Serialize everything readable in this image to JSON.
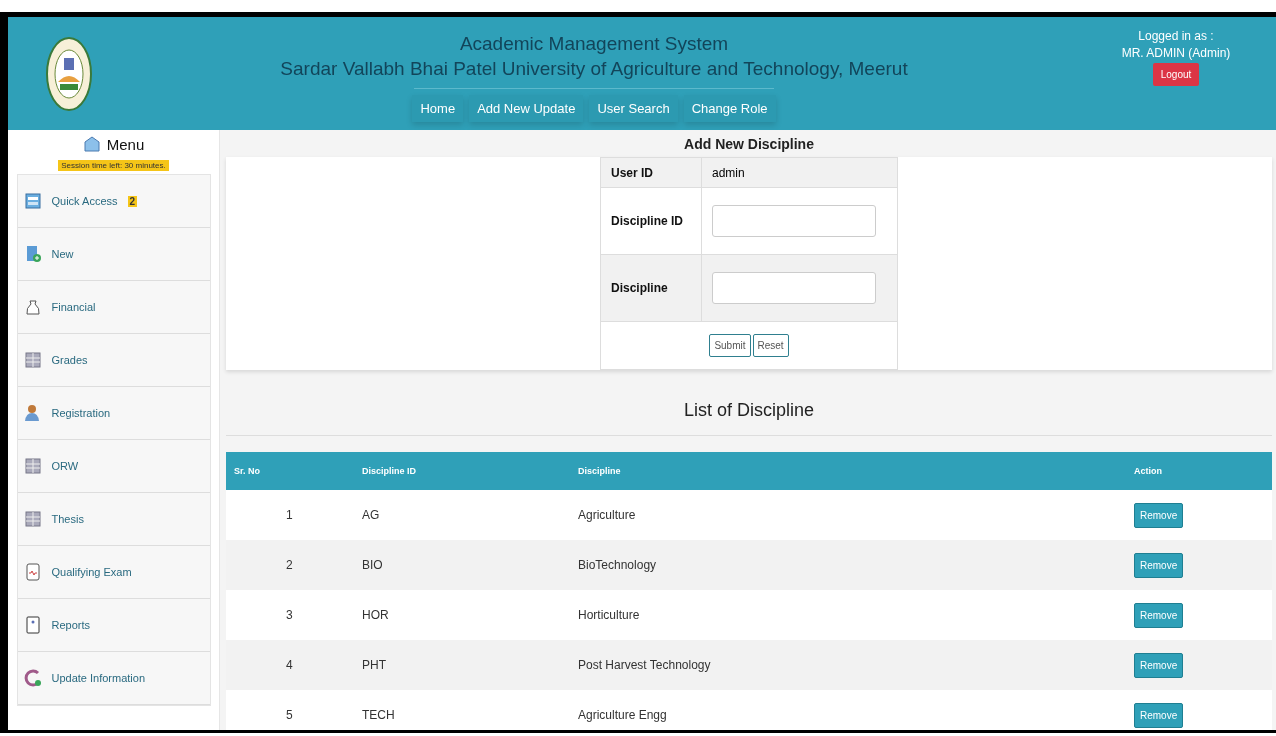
{
  "header": {
    "title": "Academic Management System",
    "subtitle": "Sardar Vallabh Bhai Patel University of Agriculture and Technology, Meerut",
    "nav": [
      "Home",
      "Add New Update",
      "User Search",
      "Change Role"
    ],
    "user": {
      "label": "Logged in as :",
      "name": "MR. ADMIN (Admin)",
      "logout": "Logout"
    }
  },
  "sidebar": {
    "title": "Menu",
    "session": "Session time left: 30 minutes.",
    "items": [
      {
        "label": "Quick Access",
        "badge": "2"
      },
      {
        "label": "New"
      },
      {
        "label": "Financial"
      },
      {
        "label": "Grades"
      },
      {
        "label": "Registration"
      },
      {
        "label": "ORW"
      },
      {
        "label": "Thesis"
      },
      {
        "label": "Qualifying Exam"
      },
      {
        "label": "Reports"
      },
      {
        "label": "Update Information"
      }
    ]
  },
  "form": {
    "title": "Add New Discipline",
    "fields": [
      {
        "label": "User ID",
        "kind": "text",
        "value": "admin"
      },
      {
        "label": "Discipline ID",
        "kind": "input"
      },
      {
        "label": "Discipline",
        "kind": "input"
      }
    ],
    "buttons": [
      "Submit",
      "Reset"
    ]
  },
  "list": {
    "title": "List of Discipline",
    "columns": [
      "Sr. No",
      "Discipline ID",
      "Discipline",
      "Action"
    ],
    "rows": [
      {
        "sr": "1",
        "id": "AG",
        "name": "Agriculture",
        "action": "Remove"
      },
      {
        "sr": "2",
        "id": "BIO",
        "name": "BioTechnology",
        "action": "Remove"
      },
      {
        "sr": "3",
        "id": "HOR",
        "name": "Horticulture",
        "action": "Remove"
      },
      {
        "sr": "4",
        "id": "PHT",
        "name": "Post Harvest Technology",
        "action": "Remove"
      },
      {
        "sr": "5",
        "id": "TECH",
        "name": "Agriculture Engg",
        "action": "Remove"
      }
    ]
  }
}
